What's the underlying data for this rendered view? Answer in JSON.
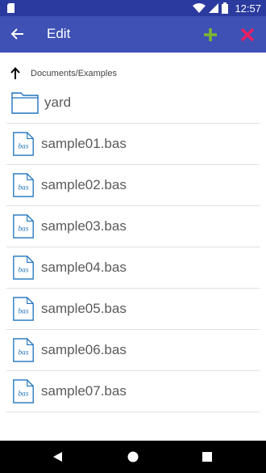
{
  "status_bar": {
    "time": "12:57"
  },
  "app_bar": {
    "title": "Edit"
  },
  "breadcrumb": {
    "path": "Documents/Examples"
  },
  "files": [
    {
      "name": "yard",
      "type": "folder"
    },
    {
      "name": "sample01.bas",
      "type": "bas"
    },
    {
      "name": "sample02.bas",
      "type": "bas"
    },
    {
      "name": "sample03.bas",
      "type": "bas"
    },
    {
      "name": "sample04.bas",
      "type": "bas"
    },
    {
      "name": "sample05.bas",
      "type": "bas"
    },
    {
      "name": "sample06.bas",
      "type": "bas"
    },
    {
      "name": "sample07.bas",
      "type": "bas"
    }
  ],
  "file_icon_label": "bas",
  "colors": {
    "primary": "#3f51b5",
    "status": "#2b3a9e",
    "add": "#7cb82f",
    "close": "#e91e63",
    "icon": "#1e73be"
  }
}
